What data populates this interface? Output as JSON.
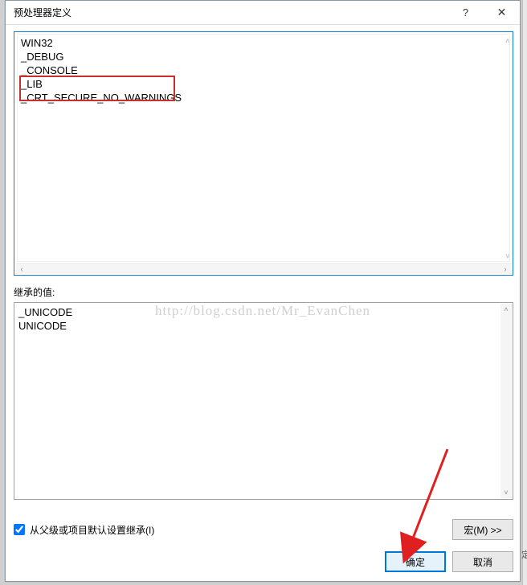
{
  "titlebar": {
    "title": "预处理器定义",
    "help_glyph": "?",
    "close_glyph": "✕"
  },
  "definitions": [
    "WIN32",
    "_DEBUG",
    "_CONSOLE",
    "_LIB",
    "_CRT_SECURE_NO_WARNINGS"
  ],
  "inherited": {
    "label": "继承的值:",
    "values": [
      "_UNICODE",
      "UNICODE"
    ]
  },
  "inherit_checkbox": {
    "label": "从父级或项目默认设置继承(I)",
    "checked": true
  },
  "buttons": {
    "macro": "宏(M) >>",
    "ok": "确定",
    "cancel": "取消"
  },
  "watermark": "http://blog.csdn.net/Mr_EvanChen",
  "right_edge_char": "定",
  "scroll": {
    "left": "‹",
    "right": "›",
    "up": "˄",
    "down": "˅"
  }
}
